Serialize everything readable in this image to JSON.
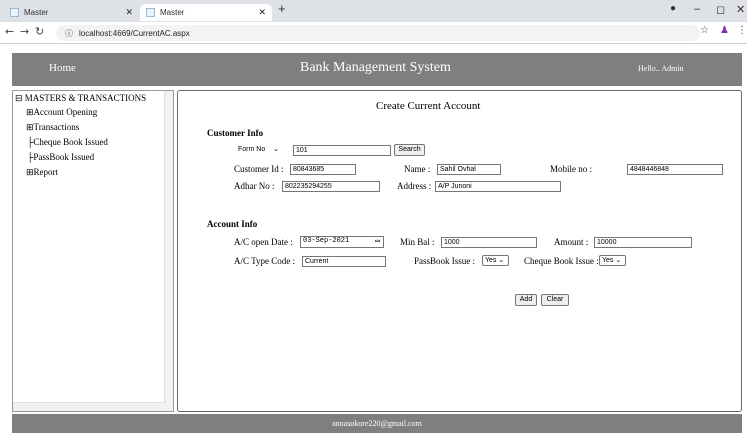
{
  "browser": {
    "tabs": [
      {
        "title": "Master"
      },
      {
        "title": "Master"
      }
    ],
    "new_tab": "+",
    "url": "localhost:4669/CurrentAC.aspx",
    "window_controls": {
      "minimize": "–",
      "maximize": "◻",
      "close": "✕"
    }
  },
  "header": {
    "home": "Home",
    "title": "Bank Management System",
    "greeting": "Hello.. Admin"
  },
  "sidebar": {
    "root": "MASTERS & TRANSACTIONS",
    "items": [
      {
        "label": "Account Opening",
        "expand": "⊞"
      },
      {
        "label": "Transactions",
        "expand": "⊞"
      },
      {
        "label": "Cheque Book Issued",
        "expand": ""
      },
      {
        "label": "PassBook Issued",
        "expand": ""
      },
      {
        "label": "Report",
        "expand": "⊞"
      }
    ]
  },
  "form": {
    "title": "Create Current Account",
    "customer_info": {
      "heading": "Customer Info",
      "form_no_select": "Form No",
      "form_no_value": "101",
      "search_button": "Search",
      "customer_id_label": "Customer Id :",
      "customer_id_value": "80843685",
      "name_label": "Name :",
      "name_value": "Sahil Ovhal",
      "mobile_label": "Mobile no :",
      "mobile_value": "4848446848",
      "adhar_label": "Adhar No :",
      "adhar_value": "802235294255",
      "address_label": "Address :",
      "address_value": "A/P Junoni"
    },
    "account_info": {
      "heading": "Account Info",
      "open_date_label": "A/C open Date :",
      "open_date_value": "03-Sep-2021",
      "min_bal_label": "Min Bal :",
      "min_bal_value": "1000",
      "amount_label": "Amount :",
      "amount_value": "10000",
      "type_code_label": "A/C Type Code :",
      "type_code_value": "Current",
      "passbook_label": "PassBook Issue :",
      "passbook_value": "Yes",
      "cheque_label": "Cheque Book Issue :",
      "cheque_value": "Yes"
    },
    "add_button": "Add",
    "clear_button": "Clear"
  },
  "footer": {
    "email": "annasokore220@gmail.com"
  }
}
